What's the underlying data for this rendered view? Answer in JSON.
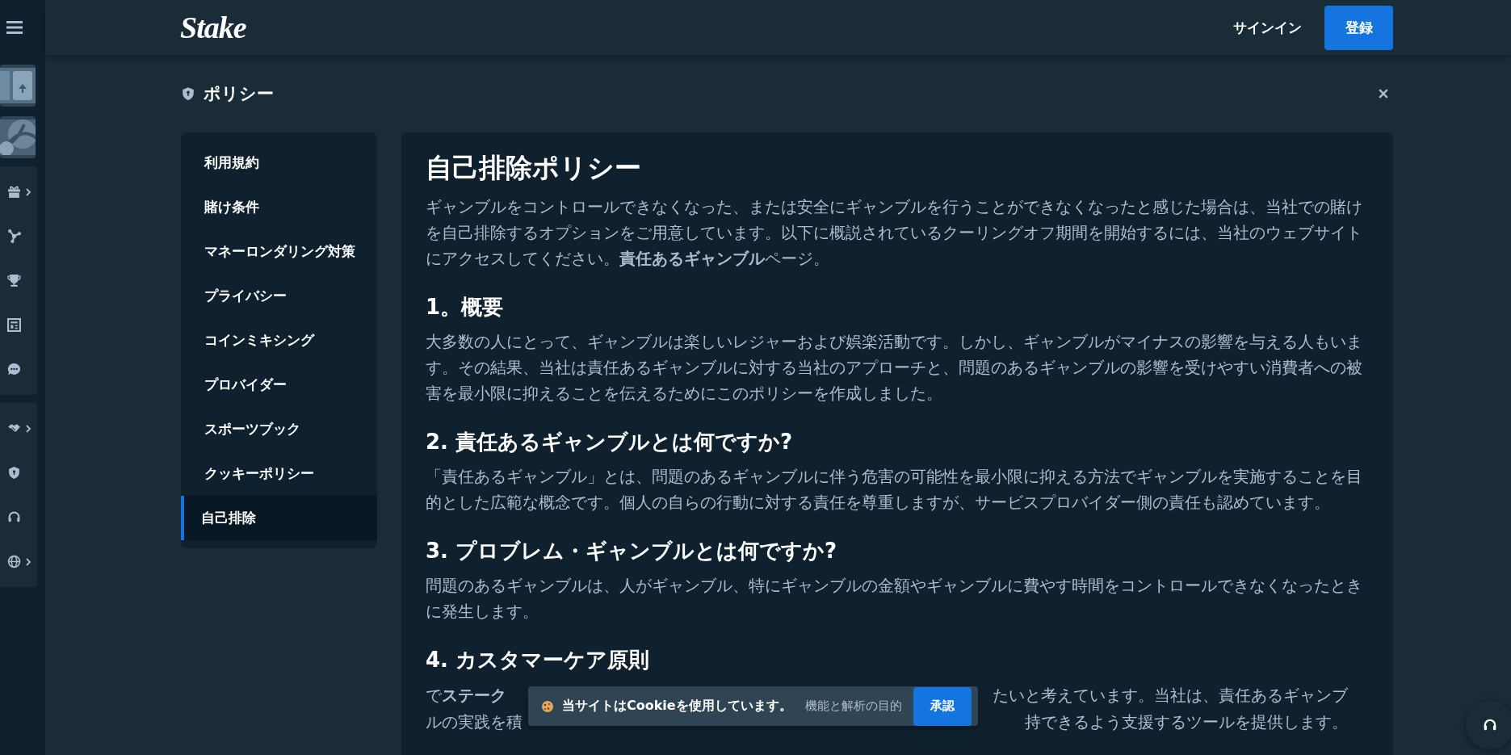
{
  "header": {
    "logo": "Stake",
    "signin": "サインイン",
    "register": "登録"
  },
  "policy": {
    "title": "ポリシー"
  },
  "nav": [
    {
      "label": "利用規約",
      "selected": false
    },
    {
      "label": "賭け条件",
      "selected": false
    },
    {
      "label": "マネーロンダリング対策",
      "selected": false
    },
    {
      "label": "プライバシー",
      "selected": false
    },
    {
      "label": "コインミキシング",
      "selected": false
    },
    {
      "label": "プロバイダー",
      "selected": false
    },
    {
      "label": "スポーツブック",
      "selected": false
    },
    {
      "label": "クッキーポリシー",
      "selected": false
    },
    {
      "label": "自己排除",
      "selected": true
    }
  ],
  "document": {
    "title": "自己排除ポリシー",
    "intro": "ギャンブルをコントロールできなくなった、または安全にギャンブルを行うことができなくなったと感じた場合は、当社での賭けを自己排除するオプションをご用意しています。以下に概説されているクーリングオフ期間を開始するには、当社のウェブサイトにアクセスしてください。**責任あるギャンブル**ページ。",
    "sections": [
      {
        "kind": "text",
        "heading": "1。概要",
        "body": "大多数の人にとって、ギャンブルは楽しいレジャーおよび娯楽活動です。しかし、ギャンブルがマイナスの影響を与える人もいます。その結果、当社は責任あるギャンブルに対する当社のアプローチと、問題のあるギャンブルの影響を受けやすい消費者への被害を最小限に抑えることを伝えるためにこのポリシーを作成しました。"
      },
      {
        "kind": "text",
        "heading": "2. 責任あるギャンブルとは何ですか?",
        "body": "「責任あるギャンブル」とは、問題のあるギャンブルに伴う危害の可能性を最小限に抑える方法でギャンブルを実施することを目的とした広範な概念です。個人の自らの行動に対する責任を尊重しますが、サービスプロバイダー側の責任も認めています。"
      },
      {
        "kind": "text",
        "heading": "3. プロブレム・ギャンブルとは何ですか?",
        "body": "問題のあるギャンブルは、人がギャンブル、特にギャンブルの金額やギャンブルに費やす時間をコントロールできなくなったときに発生します。"
      },
      {
        "kind": "covered",
        "heading": "4. カスタマーケア原則",
        "lines": [
          [
            "で**ステーク**",
            "たいと考えています。当社は、責任あるギャンブ"
          ],
          [
            "ルの実践を積",
            "持できるよう支援するツールを提供します。"
          ]
        ]
      }
    ]
  },
  "cookie": {
    "message": "当サイトはCookieを使用しています。",
    "detail": "機能と解析の目的",
    "accept": "承認"
  }
}
